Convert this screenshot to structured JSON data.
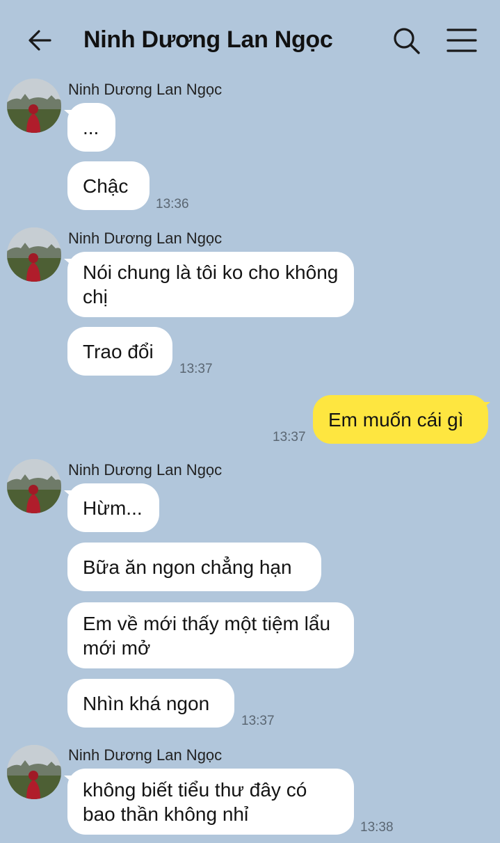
{
  "header": {
    "title": "Ninh Dương Lan Ngọc",
    "back_icon": "arrow-left-icon",
    "search_icon": "search-icon",
    "menu_icon": "hamburger-menu-icon"
  },
  "colors": {
    "background": "#b1c6db",
    "incoming_bubble": "#ffffff",
    "outgoing_bubble": "#fee640"
  },
  "messages": {
    "g1": {
      "sender": "Ninh Dương Lan Ngọc",
      "m1": "...",
      "m2": "Chậc",
      "time": "13:36"
    },
    "g2": {
      "sender": "Ninh Dương Lan Ngọc",
      "m1": "Nói chung là tôi ko cho không chị",
      "m2": "Trao đổi",
      "time": "13:37"
    },
    "out1": {
      "text": "Em muốn cái gì",
      "time": "13:37"
    },
    "g3": {
      "sender": "Ninh Dương Lan Ngọc",
      "m1": "Hừm...",
      "m2": "Bữa ăn ngon chẳng hạn",
      "m3": "Em về mới thấy một tiệm lẩu mới mở",
      "m4": "Nhìn khá ngon",
      "time": "13:37"
    },
    "g4": {
      "sender": "Ninh Dương Lan Ngọc",
      "m1": "không biết tiểu thư đây có bao thần không nhỉ",
      "time": "13:38"
    }
  }
}
